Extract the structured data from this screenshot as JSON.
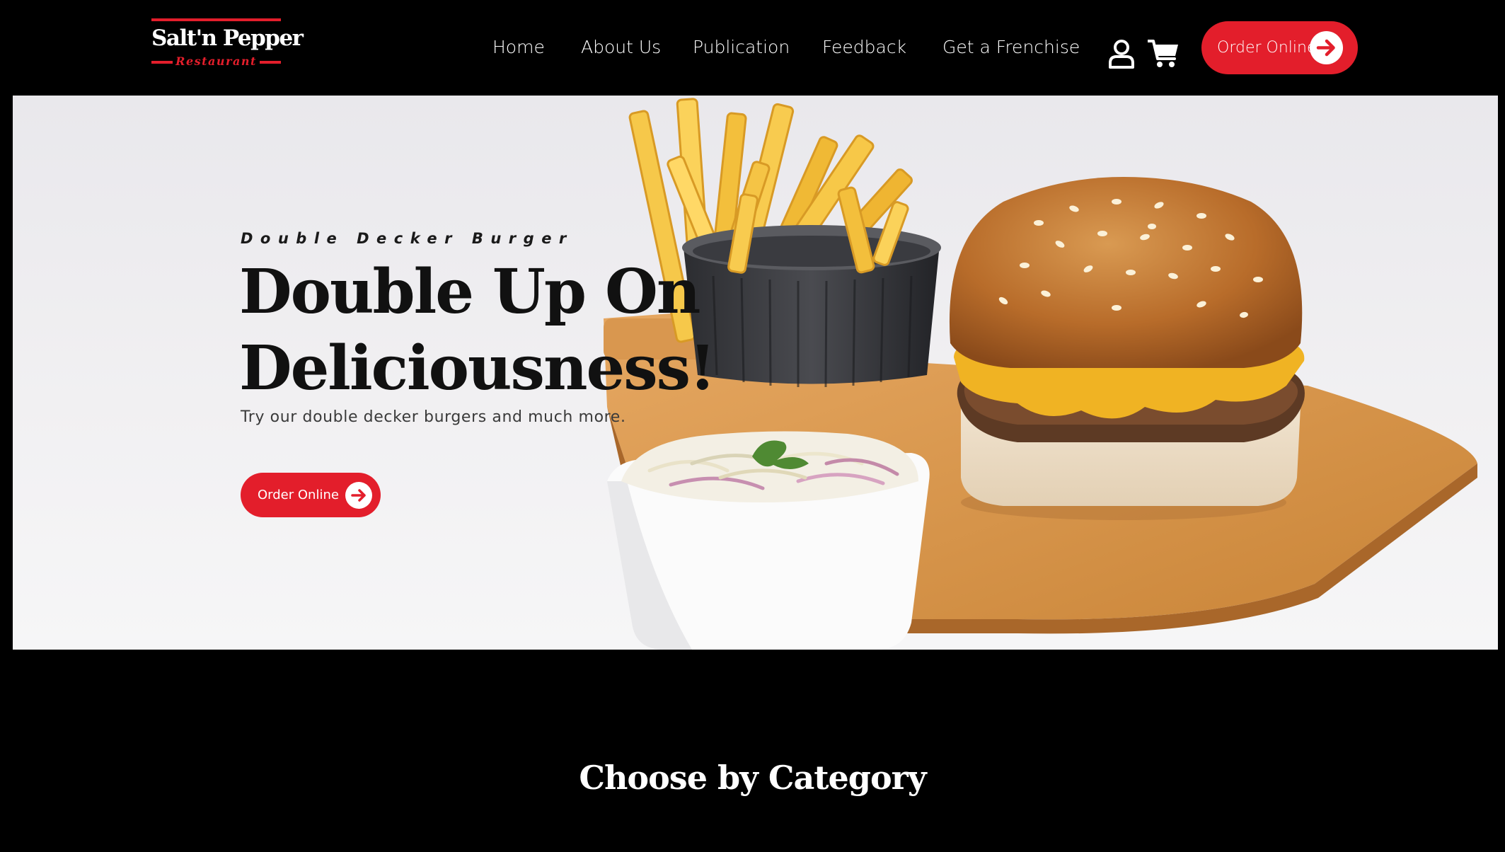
{
  "header": {
    "logo": {
      "brand": "Salt'n Pepper",
      "sub": "Restaurant"
    },
    "nav": [
      {
        "label": "Home"
      },
      {
        "label": "About Us"
      },
      {
        "label": "Publication"
      },
      {
        "label": "Feedback"
      },
      {
        "label": "Get a Frenchise"
      }
    ],
    "icons": {
      "account": "user-icon",
      "cart": "cart-icon"
    },
    "order_button": {
      "label": "Order Online",
      "icon": "arrow-right-icon"
    }
  },
  "hero": {
    "eyebrow": "Double Decker Burger",
    "headline_line1": "Double Up On",
    "headline_line2": "Deliciousness!",
    "tagline": "Try our double decker burgers and much more.",
    "order_button": {
      "label": "Order Online",
      "icon": "arrow-right-icon"
    },
    "image": "burger-fries-coleslaw-image"
  },
  "section": {
    "title": "Choose by Category"
  },
  "colors": {
    "accent": "#e31e2b",
    "background": "#000000",
    "text_light": "#ffffff"
  }
}
